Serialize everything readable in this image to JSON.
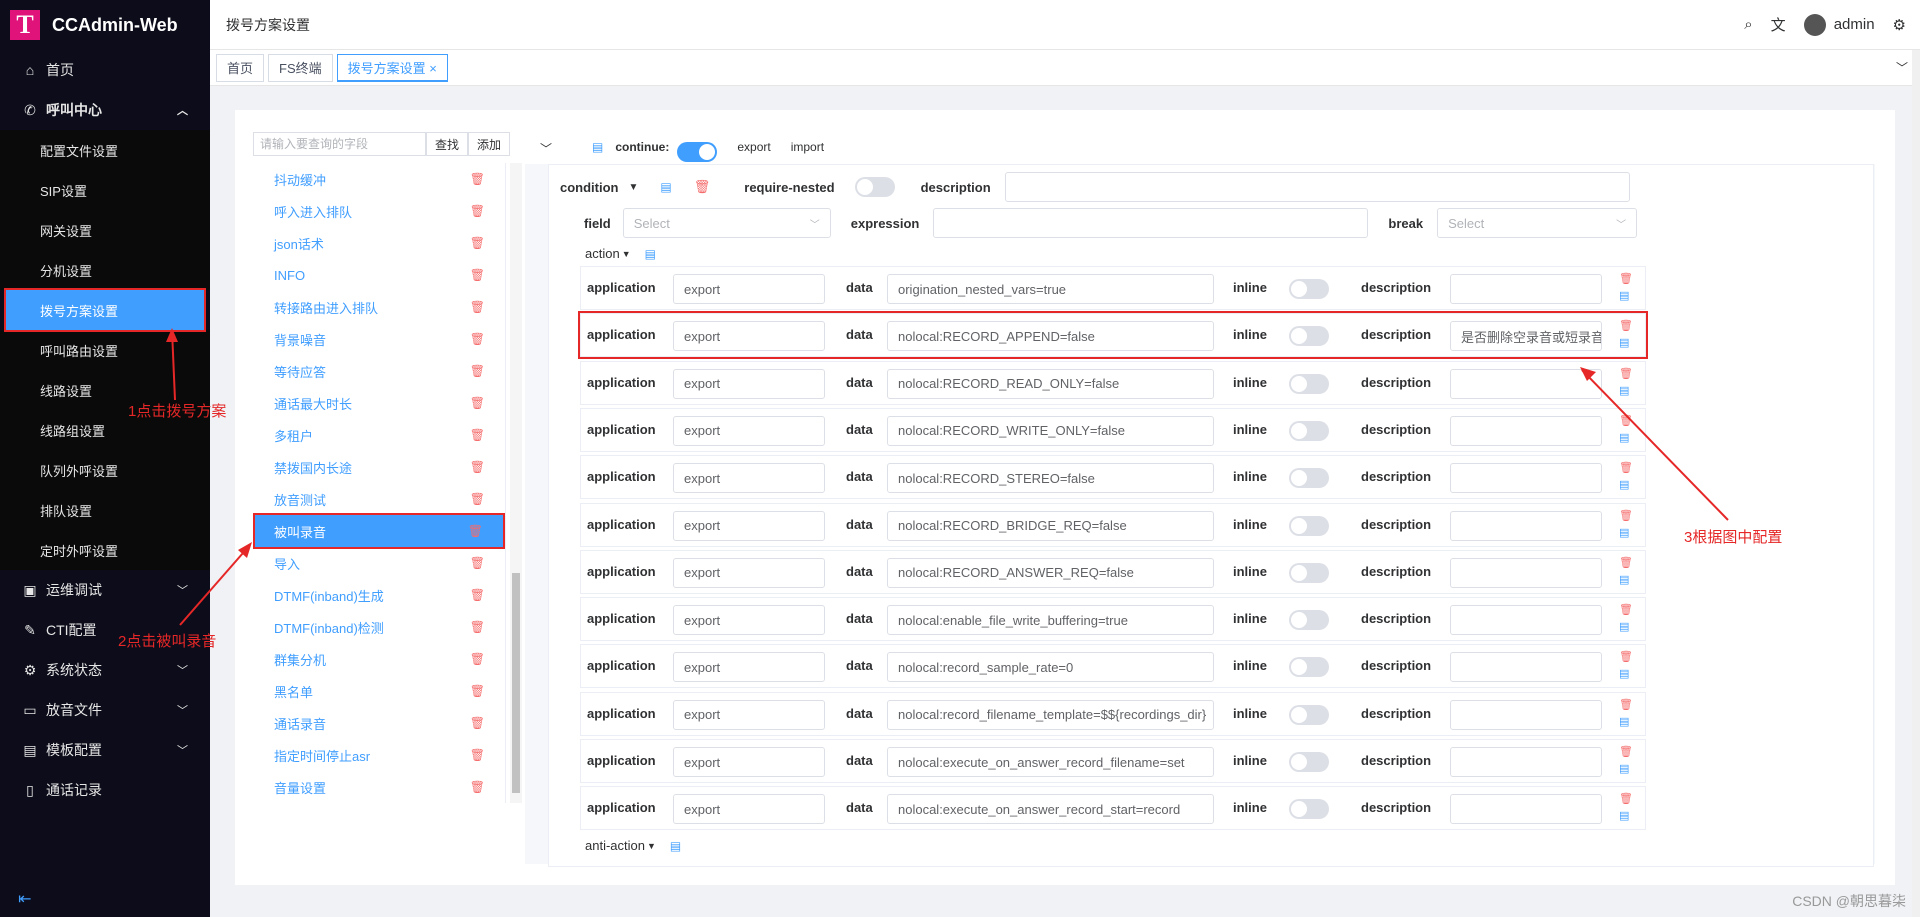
{
  "app": {
    "name": "CCAdmin-Web",
    "logo_letter": "T"
  },
  "sidebar": {
    "home": "首页",
    "call_center": "呼叫中心",
    "sub_items": [
      "配置文件设置",
      "SIP设置",
      "网关设置",
      "分机设置",
      "拨号方案设置",
      "呼叫路由设置",
      "线路设置",
      "线路组设置",
      "队列外呼设置",
      "排队设置",
      "定时外呼设置"
    ],
    "groups": [
      "运维调试",
      "CTI配置",
      "系统状态",
      "放音文件",
      "模板配置",
      "通话记录"
    ]
  },
  "header": {
    "title": "拨号方案设置",
    "user": "admin"
  },
  "tabs": [
    "首页",
    "FS终端",
    "拨号方案设置 ×"
  ],
  "search": {
    "placeholder": "请输入要查询的字段",
    "find_label": "查找",
    "add_label": "添加"
  },
  "dialplan_list": [
    "抖动缓冲",
    "呼入进入排队",
    "json话术",
    "INFO",
    "转接路由进入排队",
    "背景噪音",
    "等待应答",
    "通话最大时长",
    "多租户",
    "禁拨国内长途",
    "放音测试",
    "被叫录音",
    "导入",
    "DTMF(inband)生成",
    "DTMF(inband)检测",
    "群集分机",
    "黑名单",
    "通话录音",
    "指定时间停止asr",
    "音量设置"
  ],
  "toolbar": {
    "continue_label": "continue:",
    "export_label": "export",
    "import_label": "import"
  },
  "condition": {
    "label": "condition",
    "require_nested_label": "require-nested",
    "description_label": "description",
    "field_label": "field",
    "field_placeholder": "Select",
    "expression_label": "expression",
    "break_label": "break",
    "break_placeholder": "Select",
    "action_label": "action",
    "anti_action_label": "anti-action"
  },
  "action_labels": {
    "application": "application",
    "data": "data",
    "inline": "inline",
    "description": "description"
  },
  "actions": [
    {
      "app": "export",
      "data": "origination_nested_vars=true",
      "desc": ""
    },
    {
      "app": "export",
      "data": "nolocal:RECORD_APPEND=false",
      "desc": "是否删除空录音或短录音"
    },
    {
      "app": "export",
      "data": "nolocal:RECORD_READ_ONLY=false",
      "desc": ""
    },
    {
      "app": "export",
      "data": "nolocal:RECORD_WRITE_ONLY=false",
      "desc": ""
    },
    {
      "app": "export",
      "data": "nolocal:RECORD_STEREO=false",
      "desc": ""
    },
    {
      "app": "export",
      "data": "nolocal:RECORD_BRIDGE_REQ=false",
      "desc": ""
    },
    {
      "app": "export",
      "data": "nolocal:RECORD_ANSWER_REQ=false",
      "desc": ""
    },
    {
      "app": "export",
      "data": "nolocal:enable_file_write_buffering=true",
      "desc": ""
    },
    {
      "app": "export",
      "data": "nolocal:record_sample_rate=0",
      "desc": ""
    },
    {
      "app": "export",
      "data": "nolocal:record_filename_template=$${recordings_dir}",
      "desc": ""
    },
    {
      "app": "export",
      "data": "nolocal:execute_on_answer_record_filename=set",
      "desc": ""
    },
    {
      "app": "export",
      "data": "nolocal:execute_on_answer_record_start=record",
      "desc": ""
    }
  ],
  "annotations": [
    "1点击拨号方案",
    "2点击被叫录音",
    "3根据图中配置"
  ],
  "watermark": "CSDN @朝思暮柒"
}
